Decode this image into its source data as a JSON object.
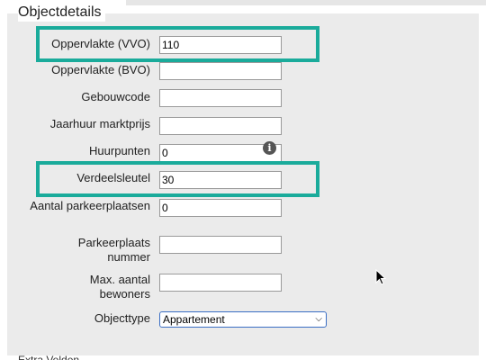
{
  "section": {
    "title": "Objectdetails",
    "fields": [
      {
        "label": "Oppervlakte (VVO)",
        "value": "110"
      },
      {
        "label": "Oppervlakte (BVO)",
        "value": ""
      },
      {
        "label": "Gebouwcode",
        "value": ""
      },
      {
        "label": "Jaarhuur marktprijs",
        "value": ""
      },
      {
        "label": "Huurpunten",
        "value": "0"
      },
      {
        "label": "Verdeelsleutel",
        "value": "30"
      },
      {
        "label": "Aantal parkeerplaatsen",
        "value": "0"
      },
      {
        "label": "Parkeerplaats nummer",
        "value": ""
      },
      {
        "label": "Max. aantal bewoners",
        "value": ""
      }
    ],
    "objecttype": {
      "label": "Objecttype",
      "selected": "Appartement"
    },
    "info_icon": "info-icon",
    "next_section_partial": "Extra Velden"
  },
  "colors": {
    "highlight": "#1aab9b",
    "panel": "#ebebeb",
    "select_border": "#3b6fc4"
  }
}
